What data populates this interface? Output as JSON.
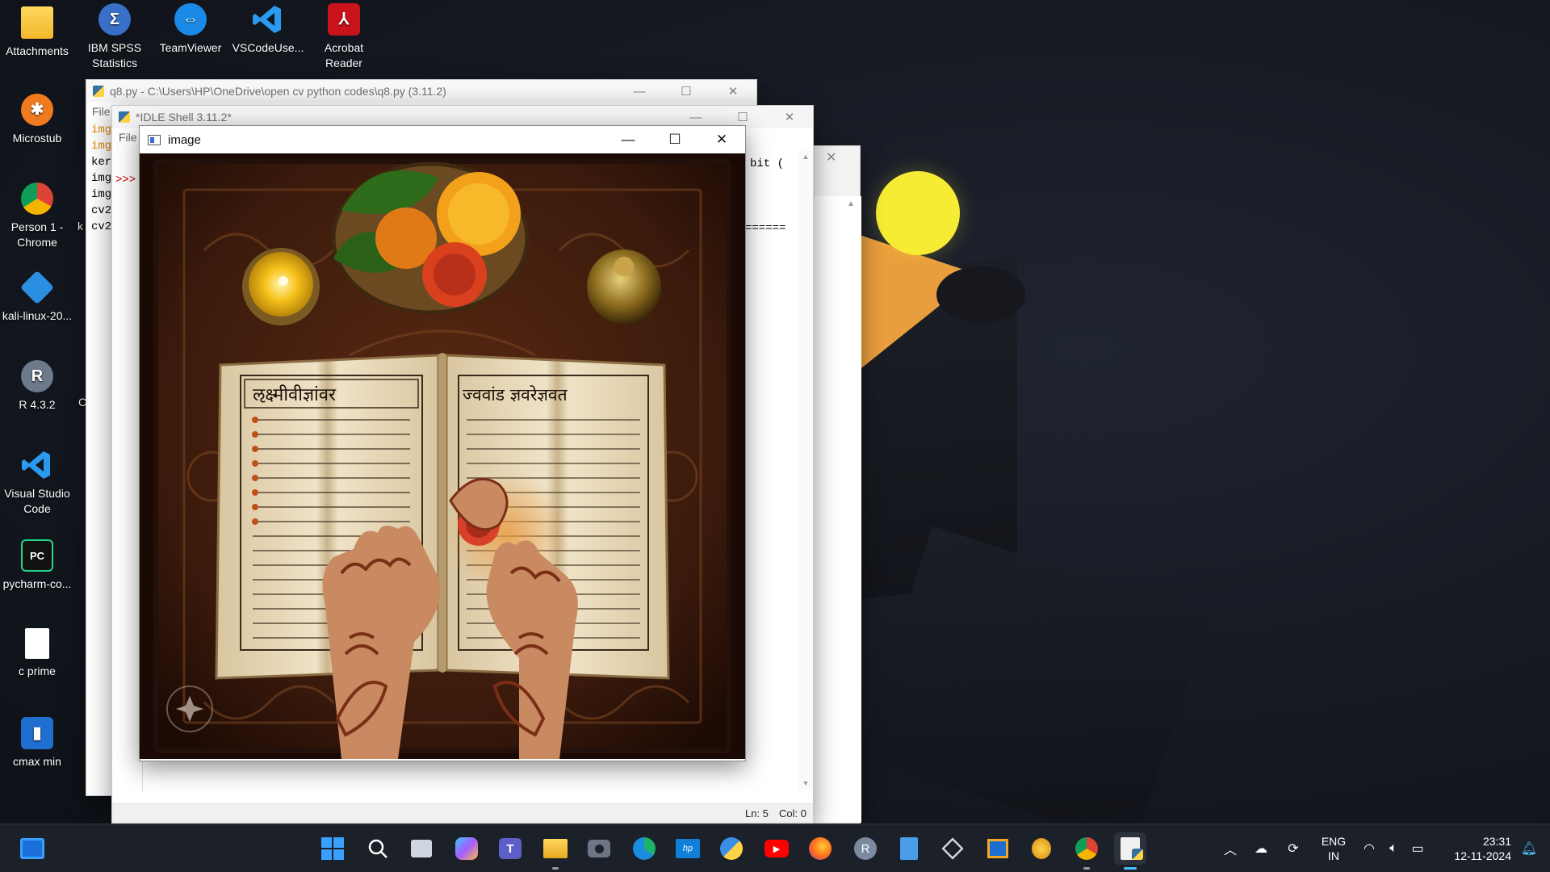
{
  "desktop": {
    "icons": [
      {
        "label": "Attachments",
        "icon": "folder-icon"
      },
      {
        "label": "IBM SPSS Statistics",
        "icon": "spss-icon"
      },
      {
        "label": "TeamViewer",
        "icon": "teamviewer-icon"
      },
      {
        "label": "VSCodeUse...",
        "icon": "vscode-icon"
      },
      {
        "label": "Acrobat Reader",
        "icon": "acrobat-icon"
      },
      {
        "label": "Microstub",
        "icon": "microstub-icon"
      },
      {
        "label": "Person 1 - Chrome",
        "icon": "chrome-icon"
      },
      {
        "label": "kali-linux-20...",
        "icon": "virtualbox-icon"
      },
      {
        "label": "R 4.3.2",
        "icon": "r-icon"
      },
      {
        "label": "Visual Studio Code",
        "icon": "vscode-icon"
      },
      {
        "label": "pycharm-co...",
        "icon": "pycharm-icon"
      },
      {
        "label": "c prime",
        "icon": "file-icon"
      },
      {
        "label": "cmax min",
        "icon": "app-icon"
      }
    ],
    "partial_icon_letters": [
      "k",
      "C"
    ]
  },
  "editor_window": {
    "title": "q8.py - C:\\Users\\HP\\OneDrive\\open cv python codes\\q8.py (3.11.2)",
    "menu_file": "File",
    "code_lines": [
      "img",
      "img",
      "ker",
      "img",
      "img",
      "cv2",
      "cv2"
    ]
  },
  "shell_window": {
    "title": "*IDLE Shell 3.11.2*",
    "menu_file": "File",
    "prompt": ">>>",
    "partial_text": "bit (",
    "separator": "======",
    "status_ln": "Ln: 5",
    "status_col": "Col: 0"
  },
  "image_window": {
    "title": "image"
  },
  "image_content": {
    "book_heading_left": "ऌक्ष्मीवीज्ञांवर",
    "book_heading_right": "ज्ववांड ज्ञवरेज्ञवत",
    "colors": {
      "wood": "#3a1a0c",
      "marigold_orange": "#f3a11a",
      "marigold_red": "#d8401e",
      "page": "#ebdcbf",
      "henna": "#7a2e15"
    }
  },
  "taskbar": {
    "language_top": "ENG",
    "language_bottom": "IN",
    "time": "23:31",
    "date": "12-11-2024",
    "apps": [
      "windows-start-icon",
      "search-icon",
      "task-view-icon",
      "copilot-icon",
      "teams-icon",
      "file-explorer-icon",
      "camera-icon",
      "edge-icon",
      "myhp-icon",
      "python-icon",
      "youtube-icon",
      "firefox-icon",
      "r-icon",
      "notepad-icon",
      "virtualbox-icon",
      "remote-desktop-icon",
      "medal-icon",
      "chrome-icon",
      "idle-icon"
    ]
  }
}
